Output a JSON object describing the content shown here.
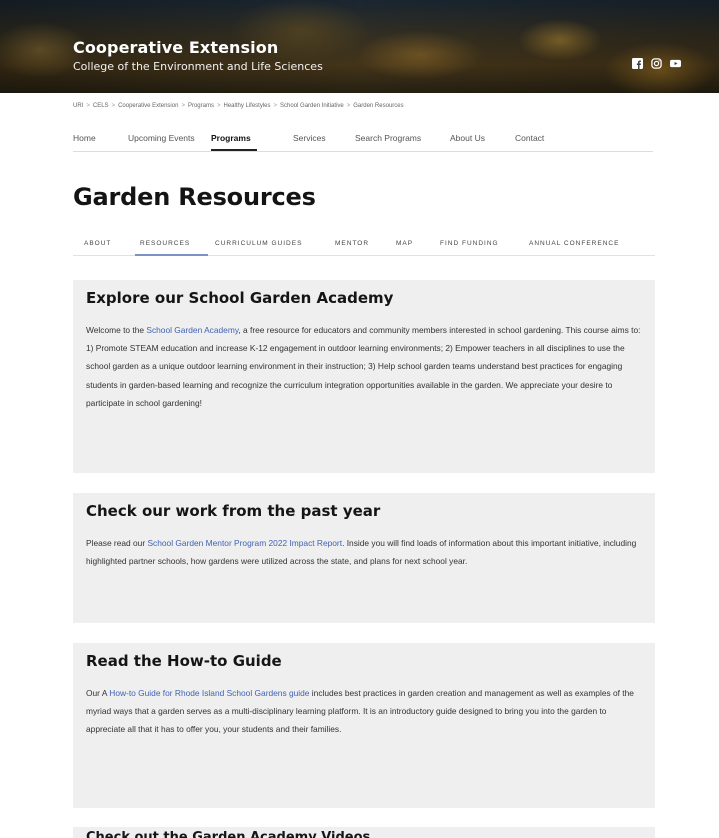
{
  "header": {
    "title": "Cooperative Extension",
    "subtitle": "College of the Environment and Life Sciences",
    "social": [
      {
        "icon": "facebook-icon"
      },
      {
        "icon": "instagram-icon"
      },
      {
        "icon": "youtube-icon"
      }
    ]
  },
  "breadcrumb": [
    "URI",
    "CELS",
    "Cooperative Extension",
    "Programs",
    "Healthy Lifestyles",
    "School Garden Initiative",
    "Garden Resources"
  ],
  "nav": {
    "items": [
      "Home",
      "Upcoming Events",
      "Programs",
      "Services",
      "Search Programs",
      "About Us",
      "Contact"
    ],
    "active": "Programs"
  },
  "page_title": "Garden Resources",
  "subnav": {
    "tabs": [
      "ABOUT",
      "RESOURCES",
      "CURRICULUM GUIDES",
      "MENTOR",
      "MAP",
      "FIND FUNDING",
      "ANNUAL CONFERENCE"
    ],
    "active": "RESOURCES"
  },
  "sections": {
    "academy": {
      "heading": "Explore our School Garden Academy",
      "text_before": "Welcome to the ",
      "link": "School Garden Academy",
      "text_after": ", a free resource for educators and community members interested in school gardening. This course aims to: 1) Promote STEAM education and increase K-12 engagement in outdoor learning environments; 2) Empower teachers in all disciplines to use the school garden as a unique outdoor learning environment in their instruction; 3) Help school garden teams understand best practices for engaging students in garden-based learning and recognize the curriculum integration opportunities available in the garden. We appreciate your desire to participate in school gardening!"
    },
    "work": {
      "heading": "Check our work from the past year",
      "text_before": "Please read our ",
      "link": "School Garden Mentor Program 2022 Impact Report",
      "text_after": ". Inside you will find loads of information about this important initiative, including highlighted partner schools, how gardens were utilized across the state, and plans for next school year."
    },
    "guide": {
      "heading": "Read the How-to Guide",
      "text_before": "Our A ",
      "link": "How-to Guide for Rhode Island School Gardens guide",
      "text_after": " includes best practices in garden creation and management as well as examples of the myriad ways that a garden serves as a multi-disciplinary learning platform. It is an introductory guide designed to bring you into the garden to appreciate all that it has to offer you, your students and their families."
    },
    "next": {
      "heading": "Check out the Garden Academy Videos"
    }
  },
  "colors": {
    "link": "#3f63b4",
    "card_bg": "#efefef",
    "tab_underline": "#7b92c7"
  }
}
